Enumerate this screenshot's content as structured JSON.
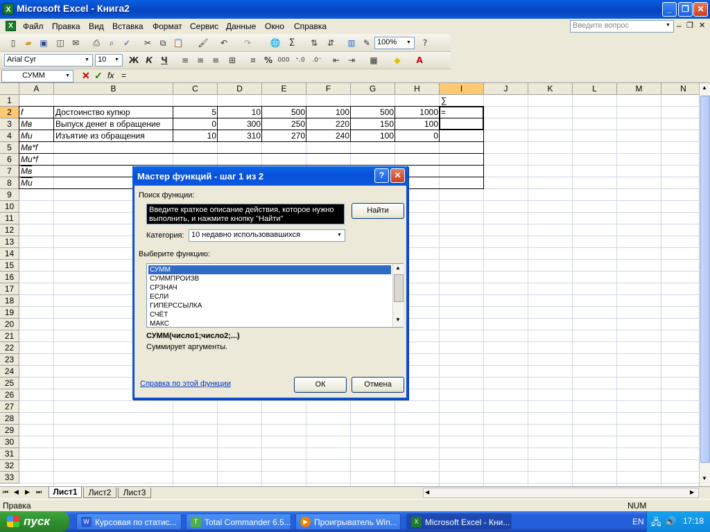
{
  "window": {
    "title": "Microsoft Excel - Книга2",
    "min": "_",
    "restore": "❐",
    "close": "✕"
  },
  "menu": {
    "items": [
      "Файл",
      "Правка",
      "Вид",
      "Вставка",
      "Формат",
      "Сервис",
      "Данные",
      "Окно",
      "Справка"
    ],
    "help_placeholder": "Введите вопрос"
  },
  "toolbar": {
    "zoom": "100%",
    "font_name": "Arial Cyr",
    "font_size": "10",
    "bold": "Ж",
    "italic": "К",
    "underline": "Ч",
    "percent": "%",
    "thousands": "000",
    "sigma": "Σ"
  },
  "formula_bar": {
    "name_box": "СУММ",
    "cancel": "✕",
    "enter": "✓",
    "fx": "fx",
    "content": "="
  },
  "grid": {
    "columns": [
      "A",
      "B",
      "C",
      "D",
      "E",
      "F",
      "G",
      "H",
      "I",
      "J",
      "K",
      "L",
      "M",
      "N"
    ],
    "rows": [
      "1",
      "2",
      "3",
      "4",
      "5",
      "6",
      "7",
      "8",
      "9",
      "10",
      "11",
      "12",
      "13",
      "14",
      "15",
      "16",
      "17",
      "18",
      "19",
      "20",
      "21",
      "22",
      "23",
      "24",
      "25",
      "26",
      "27",
      "28",
      "29",
      "30",
      "31",
      "32",
      "33"
    ],
    "cells": {
      "I1": "∑",
      "A2": "f",
      "B2": "Достоинство купюр",
      "C2": "5",
      "D2": "10",
      "E2": "500",
      "F2": "100",
      "G2": "500",
      "H2": "1000",
      "I2": "=",
      "A3": "Мв",
      "B3": "Выпуск денег в обращение",
      "C3": "0",
      "D3": "300",
      "E3": "250",
      "F3": "220",
      "G3": "150",
      "H3": "100",
      "A4": "Ми",
      "B4": "Изъятие из обращения",
      "C4": "10",
      "D4": "310",
      "E4": "270",
      "F4": "240",
      "G4": "100",
      "H4": "0",
      "A5": "Мв*f",
      "A6": "Ми*f",
      "A7": "Мв",
      "A8": "Ми"
    }
  },
  "sheets": {
    "tabs": [
      "Лист1",
      "Лист2",
      "Лист3"
    ],
    "active": "Лист1"
  },
  "status": {
    "left": "Правка",
    "num": "NUM"
  },
  "dialog": {
    "title": "Мастер функций - шаг 1 из 2",
    "help_btn": "?",
    "close_btn": "✕",
    "search_label": "Поиск функции:",
    "search_text": "Введите краткое описание действия, которое нужно выполнить, и нажмите кнопку \"Найти\"",
    "find_button": "Найти",
    "category_label": "Категория:",
    "category_value": "10 недавно использовавшихся",
    "select_label": "Выберите функцию:",
    "functions": [
      "СУММ",
      "СУММПРОИЗВ",
      "СРЗНАЧ",
      "ЕСЛИ",
      "ГИПЕРССЫЛКА",
      "СЧЁТ",
      "МАКС"
    ],
    "selected": "СУММ",
    "signature": "СУММ(число1;число2;...)",
    "description": "Суммирует аргументы.",
    "help_link": "Справка по этой функции",
    "ok": "ОК",
    "cancel": "Отмена"
  },
  "taskbar": {
    "start": "пуск",
    "tasks": [
      "Курсовая по статис...",
      "Total Commander 6.5...",
      "Проигрыватель Win...",
      "Microsoft Excel - Кни..."
    ],
    "lang": "EN",
    "clock": "17:18"
  },
  "colors": {
    "selection": "#316ac5",
    "title_blue": "#0a5fe0",
    "start_green": "#2f8f2f"
  }
}
